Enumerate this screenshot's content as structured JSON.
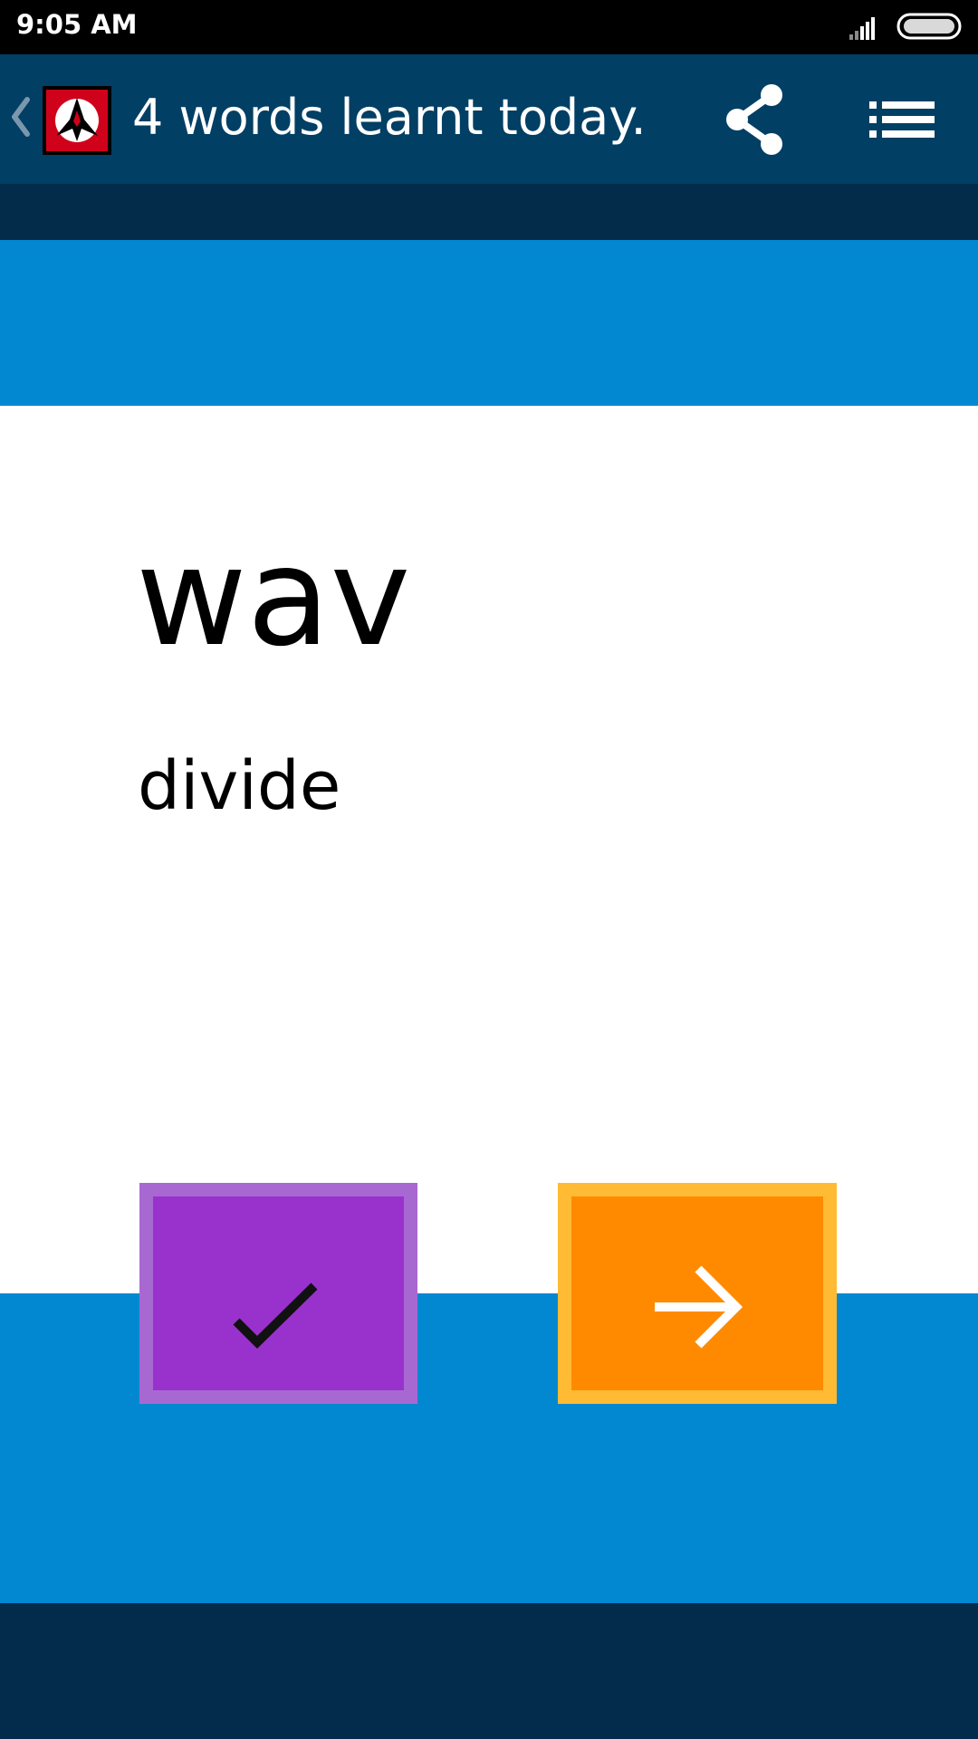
{
  "status_bar": {
    "time": "9:05 AM",
    "signal_icon": "signal-icon",
    "battery_icon": "battery-icon"
  },
  "app_bar": {
    "back_icon": "back-chevron-icon",
    "logo_icon": "klingon-emblem-icon",
    "title": "4 words learnt today.",
    "share_icon": "share-icon",
    "menu_icon": "list-menu-icon"
  },
  "flashcard": {
    "word": "wav",
    "meaning": "divide"
  },
  "actions": {
    "known_icon": "checkmark-icon",
    "next_icon": "arrow-right-icon"
  },
  "colors": {
    "status_bar": "#000000",
    "app_bar": "#023f64",
    "blue_band": "#0288d1",
    "footer": "#032b4b",
    "known_button": "#9932cc",
    "known_button_border": "#a868d2",
    "next_button": "#ff8a00",
    "next_button_border": "#ffbb33"
  }
}
